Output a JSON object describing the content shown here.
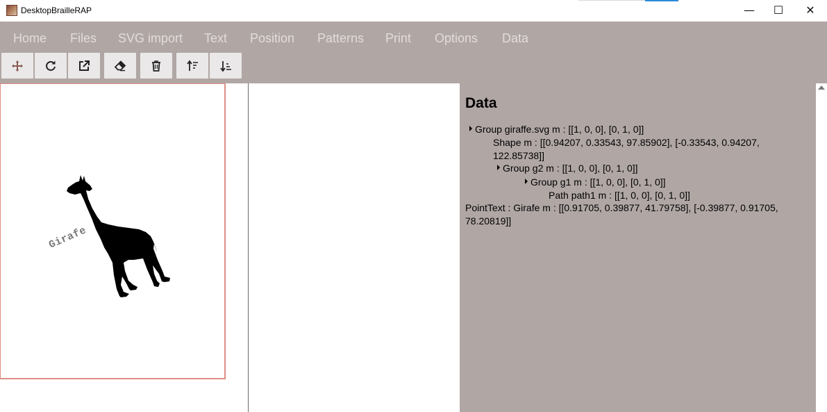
{
  "window": {
    "title": "DesktopBrailleRAP",
    "minimize": "—",
    "maximize": "☐",
    "close": "✕"
  },
  "menu": [
    {
      "label": "Home"
    },
    {
      "label": "Files"
    },
    {
      "label": "SVG import"
    },
    {
      "label": "Text"
    },
    {
      "label": "Position"
    },
    {
      "label": "Patterns"
    },
    {
      "label": "Print"
    },
    {
      "label": "Options"
    },
    {
      "label": "Data"
    }
  ],
  "toolbar": [
    {
      "icon": "move-icon"
    },
    {
      "icon": "rotate-icon"
    },
    {
      "icon": "external-link-icon"
    },
    {
      "icon": "eraser-icon"
    },
    {
      "icon": "trash-icon"
    },
    {
      "icon": "sort-ascending-icon"
    },
    {
      "icon": "sort-descending-icon"
    }
  ],
  "preview": {
    "text_label": "Girafe"
  },
  "data_panel": {
    "title": "Data",
    "tree": [
      {
        "text": "Group giraffe.svg m : [[1, 0, 0], [0, 1, 0]]"
      },
      {
        "text": "Shape m : [[0.94207, 0.33543, 97.85902], [-0.33543, 0.94207, 122.85738]]"
      },
      {
        "text": "Group g2 m : [[1, 0, 0], [0, 1, 0]]"
      },
      {
        "text": "Group g1 m : [[1, 0, 0], [0, 1, 0]]"
      },
      {
        "text": "Path path1 m : [[1, 0, 0], [0, 1, 0]]"
      },
      {
        "text": "PointText : Girafe m : [[0.91705, 0.39877, 41.79758], [-0.39877, 0.91705, 78.20819]]"
      }
    ]
  },
  "colors": {
    "ribbon": "#b0a7a5",
    "menu_text": "#e1dcdb",
    "button_bg": "#eae8e8",
    "page_border": "#e08d85",
    "move_icon": "#8a5a52"
  }
}
